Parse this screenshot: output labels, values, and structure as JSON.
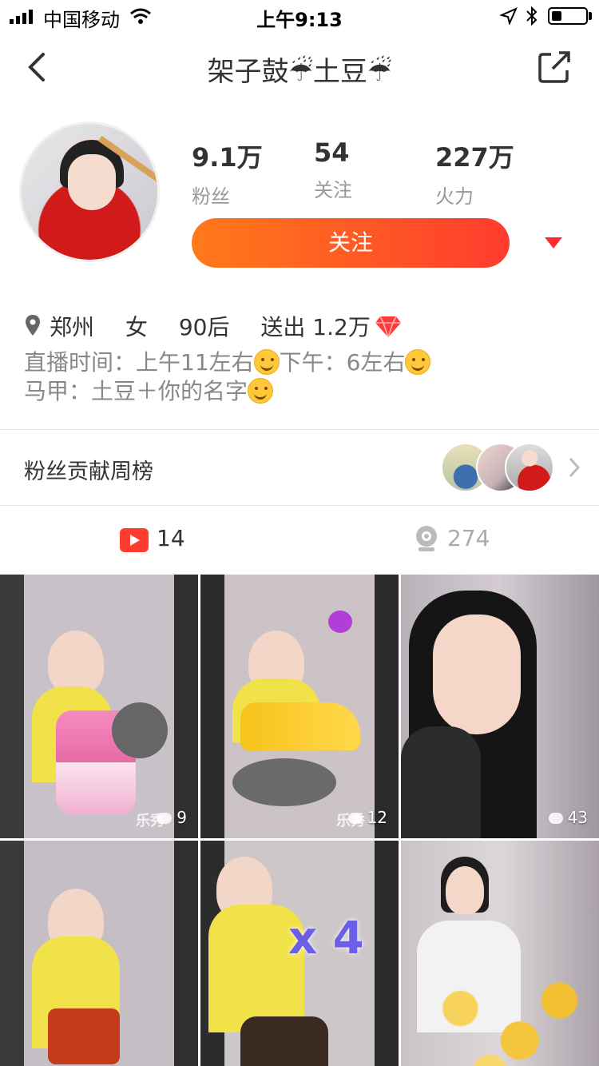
{
  "status_bar": {
    "carrier": "中国移动",
    "time": "上午9:13"
  },
  "nav": {
    "title": "架子鼓☔土豆☔"
  },
  "profile": {
    "stats": [
      {
        "num": "9.1万",
        "label": "粉丝"
      },
      {
        "num": "54",
        "label": "关注"
      },
      {
        "num": "227万",
        "label": "火力"
      }
    ],
    "follow_label": "关注",
    "city": "郑州",
    "gender": "女",
    "age": "90后",
    "sent": "送出 1.2万",
    "bio_line1_a": "直播时间：上午11左右",
    "bio_line1_b": "下午：6左右",
    "bio_line2": "马甲：土豆＋你的名字"
  },
  "fan_rank": {
    "label": "粉丝贡献周榜"
  },
  "tabs": [
    {
      "icon": "video-play-icon",
      "count": "14"
    },
    {
      "icon": "webcam-icon",
      "count": "274"
    }
  ],
  "grid": {
    "tiles": [
      {
        "count": "9",
        "watermark": "乐秀"
      },
      {
        "count": "12",
        "watermark": "乐秀"
      },
      {
        "count": "43",
        "watermark": ""
      },
      {
        "count": "",
        "watermark": ""
      },
      {
        "count": "",
        "watermark": ""
      },
      {
        "count": "",
        "watermark": ""
      }
    ],
    "overlay_text": "x 4"
  },
  "colors": {
    "accent_start": "#ff7a1a",
    "accent_end": "#ff3c2e",
    "dropdown": "#ff2d2d"
  }
}
